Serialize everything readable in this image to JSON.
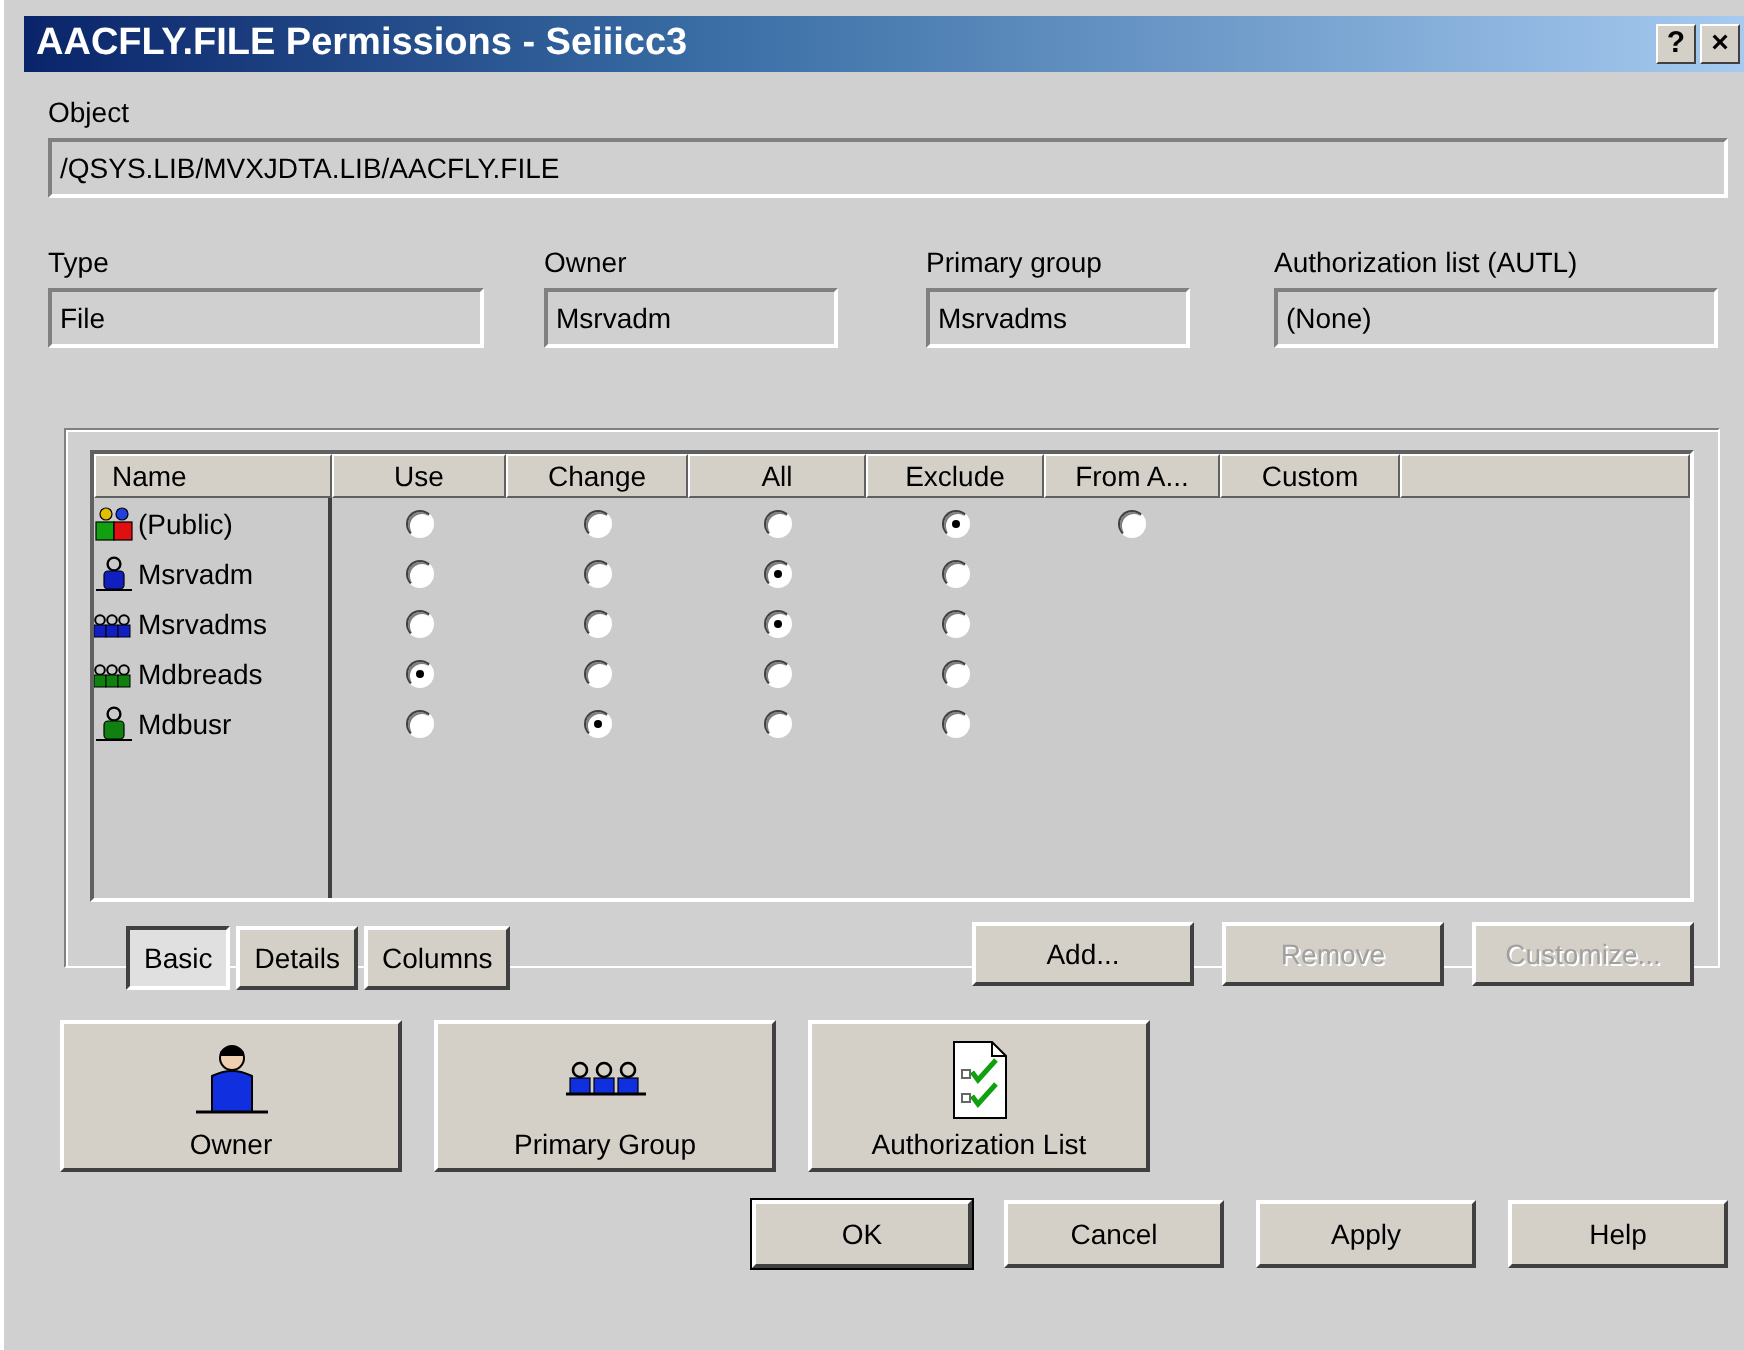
{
  "window": {
    "title": "AACFLY.FILE Permissions - Seiiicc3",
    "help_glyph": "?",
    "close_glyph": "×"
  },
  "object": {
    "label": "Object",
    "value": "/QSYS.LIB/MVXJDTA.LIB/AACFLY.FILE"
  },
  "fields": [
    {
      "label": "Type",
      "value": "File"
    },
    {
      "label": "Owner",
      "value": "Msrvadm"
    },
    {
      "label": "Primary group",
      "value": "Msrvadms"
    },
    {
      "label": "Authorization list (AUTL)",
      "value": "(None)"
    }
  ],
  "table": {
    "columns": [
      "Name",
      "Use",
      "Change",
      "All",
      "Exclude",
      "From A...",
      "Custom"
    ],
    "rows": [
      {
        "name": "(Public)",
        "kind": "public",
        "options": [
          {
            "selected": false
          },
          {
            "selected": false
          },
          {
            "selected": false
          },
          {
            "selected": true
          },
          {
            "selected": false
          }
        ]
      },
      {
        "name": "Msrvadm",
        "kind": "user",
        "color": "#1020c0",
        "options": [
          {
            "selected": false
          },
          {
            "selected": false
          },
          {
            "selected": true
          },
          {
            "selected": false
          }
        ]
      },
      {
        "name": "Msrvadms",
        "kind": "group",
        "color": "#1020c0",
        "options": [
          {
            "selected": false
          },
          {
            "selected": false
          },
          {
            "selected": true
          },
          {
            "selected": false
          }
        ]
      },
      {
        "name": "Mdbreads",
        "kind": "group",
        "color": "#108010",
        "options": [
          {
            "selected": true
          },
          {
            "selected": false
          },
          {
            "selected": false
          },
          {
            "selected": false
          }
        ]
      },
      {
        "name": "Mdbusr",
        "kind": "user",
        "color": "#108010",
        "options": [
          {
            "selected": false
          },
          {
            "selected": true
          },
          {
            "selected": false
          },
          {
            "selected": false
          }
        ]
      }
    ]
  },
  "view_tabs": [
    {
      "label": "Basic",
      "selected": true
    },
    {
      "label": "Details",
      "selected": false
    },
    {
      "label": "Columns",
      "selected": false
    }
  ],
  "list_buttons": [
    {
      "label": "Add...",
      "disabled": false
    },
    {
      "label": "Remove",
      "disabled": true
    },
    {
      "label": "Customize...",
      "disabled": true
    }
  ],
  "big_buttons": [
    {
      "label": "Owner",
      "kind": "owner"
    },
    {
      "label": "Primary Group",
      "kind": "group"
    },
    {
      "label": "Authorization List",
      "kind": "list"
    }
  ],
  "buttons": [
    "OK",
    "Cancel",
    "Apply",
    "Help"
  ]
}
